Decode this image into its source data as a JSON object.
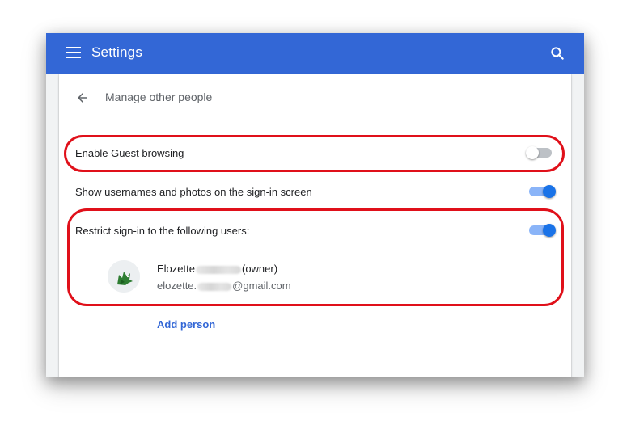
{
  "appbar": {
    "title": "Settings",
    "color": "#3367d6"
  },
  "page": {
    "title": "Manage other people"
  },
  "settings": [
    {
      "label": "Enable Guest browsing",
      "enabled": false
    },
    {
      "label": "Show usernames and photos on the sign-in screen",
      "enabled": true
    },
    {
      "label": "Restrict sign-in to the following users:",
      "enabled": true
    }
  ],
  "users": [
    {
      "name_prefix": "Elozette",
      "name_suffix": "(owner)",
      "email_prefix": "elozette.",
      "email_suffix": "@gmail.com"
    }
  ],
  "add_person_label": "Add person",
  "colors": {
    "accent": "#1a73e8",
    "highlight": "#e0101a"
  },
  "icons": [
    "menu-icon",
    "search-icon",
    "back-arrow-icon",
    "avatar"
  ]
}
